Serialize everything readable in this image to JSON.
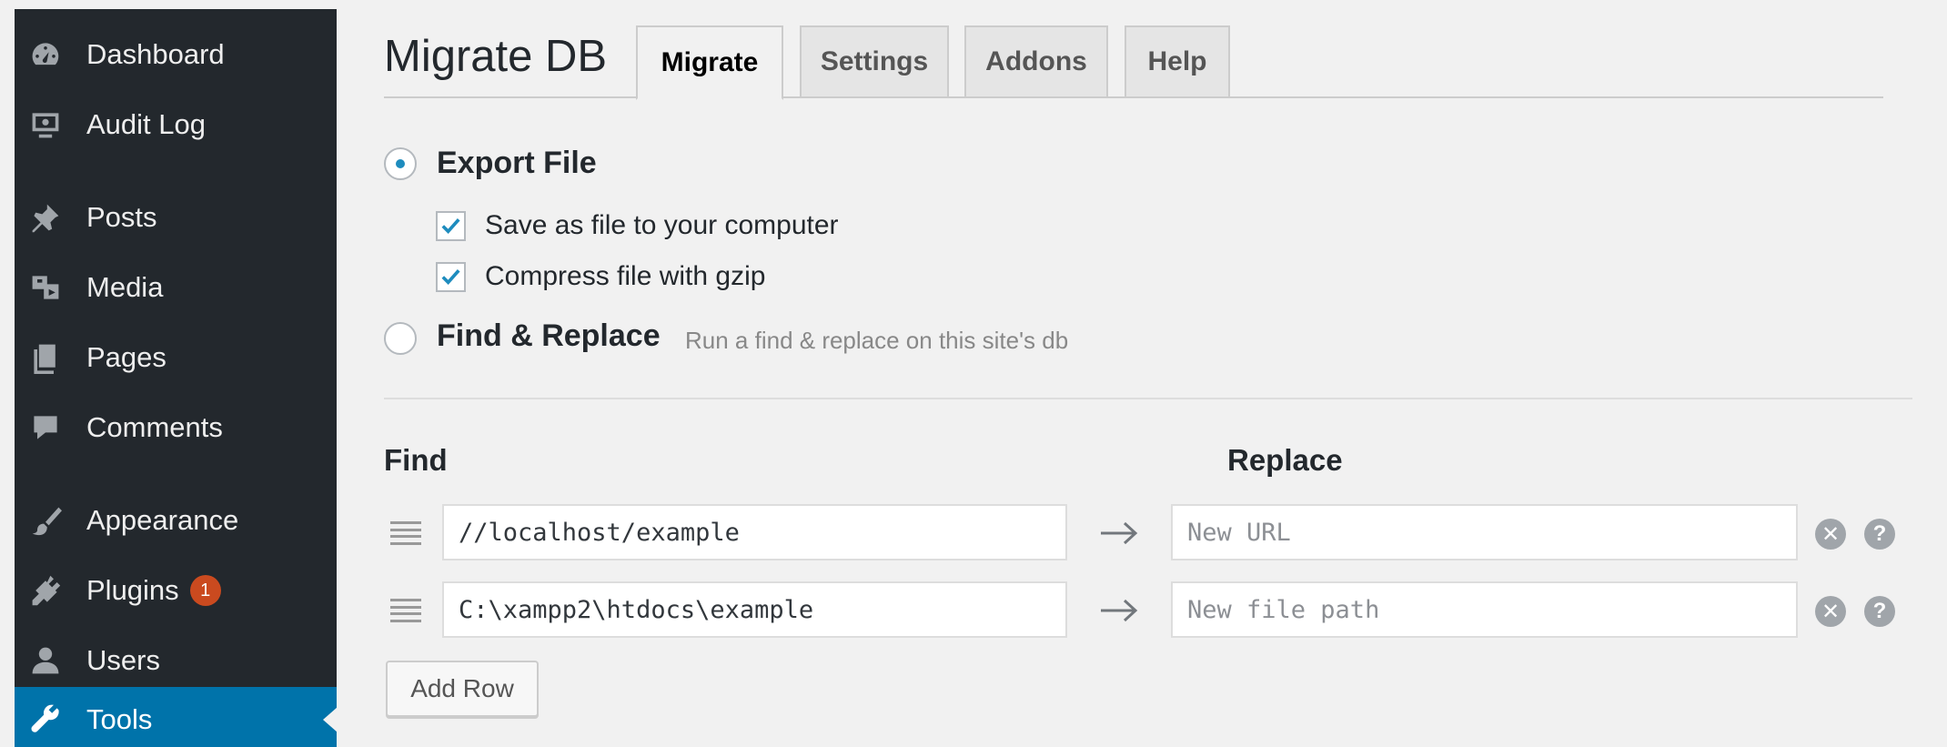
{
  "sidebar": {
    "items": [
      {
        "label": "Dashboard",
        "icon": "dashboard-icon"
      },
      {
        "label": "Audit Log",
        "icon": "monitor-icon"
      },
      {
        "label": "Posts",
        "icon": "pin-icon"
      },
      {
        "label": "Media",
        "icon": "media-icon"
      },
      {
        "label": "Pages",
        "icon": "pages-icon"
      },
      {
        "label": "Comments",
        "icon": "comment-icon"
      },
      {
        "label": "Appearance",
        "icon": "paintbrush-icon"
      },
      {
        "label": "Plugins",
        "icon": "plug-icon",
        "badge": "1"
      },
      {
        "label": "Users",
        "icon": "user-icon"
      },
      {
        "label": "Tools",
        "icon": "wrench-icon",
        "active": true
      }
    ]
  },
  "header": {
    "title": "Migrate DB",
    "tabs": [
      {
        "label": "Migrate",
        "active": true
      },
      {
        "label": "Settings"
      },
      {
        "label": "Addons"
      },
      {
        "label": "Help"
      }
    ]
  },
  "options": {
    "export": {
      "label": "Export File",
      "checked": true
    },
    "save_file": {
      "label": "Save as file to your computer",
      "checked": true
    },
    "gzip": {
      "label": "Compress file with gzip",
      "checked": true
    },
    "find_replace": {
      "label": "Find & Replace",
      "desc": "Run a find & replace on this site's db",
      "checked": false
    }
  },
  "table": {
    "find_header": "Find",
    "replace_header": "Replace",
    "rows": [
      {
        "find": "//localhost/example",
        "replace_placeholder": "New URL"
      },
      {
        "find": "C:\\xampp2\\htdocs\\example",
        "replace_placeholder": "New file path"
      }
    ],
    "add_row_label": "Add Row"
  },
  "colors": {
    "sidebar_bg": "#23282d",
    "active_bg": "#0073aa",
    "badge_bg": "#ca4a1f",
    "page_bg": "#f1f1f1"
  }
}
